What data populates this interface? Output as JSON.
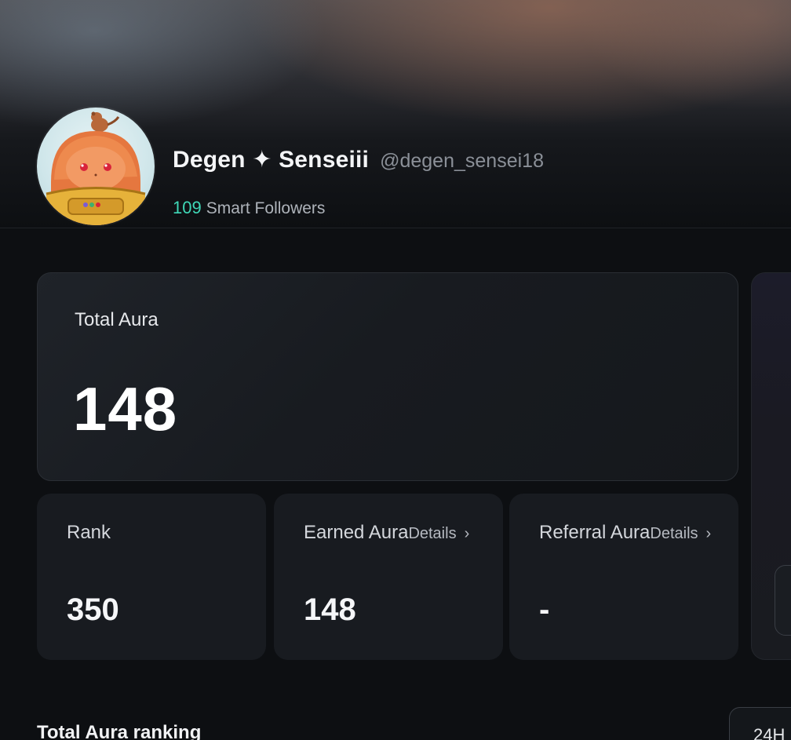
{
  "profile": {
    "display_name": "Degen ✦ Senseiii",
    "handle": "@degen_sensei18",
    "smart_followers_count": "109",
    "smart_followers_label": "Smart Followers"
  },
  "total_aura": {
    "title": "Total Aura",
    "value": "148"
  },
  "stats": {
    "rank": {
      "label": "Rank",
      "value": "350"
    },
    "earned": {
      "label": "Earned Aura",
      "details": "Details",
      "chevron": "›",
      "value": "148"
    },
    "referral": {
      "label": "Referral Aura",
      "details": "Details",
      "chevron": "›",
      "value": "-"
    }
  },
  "ranking": {
    "title": "Total Aura ranking",
    "range_button": "24H"
  },
  "colors": {
    "accent": "#3fd8b7",
    "background": "#0d0f12",
    "card": "#181b20"
  }
}
